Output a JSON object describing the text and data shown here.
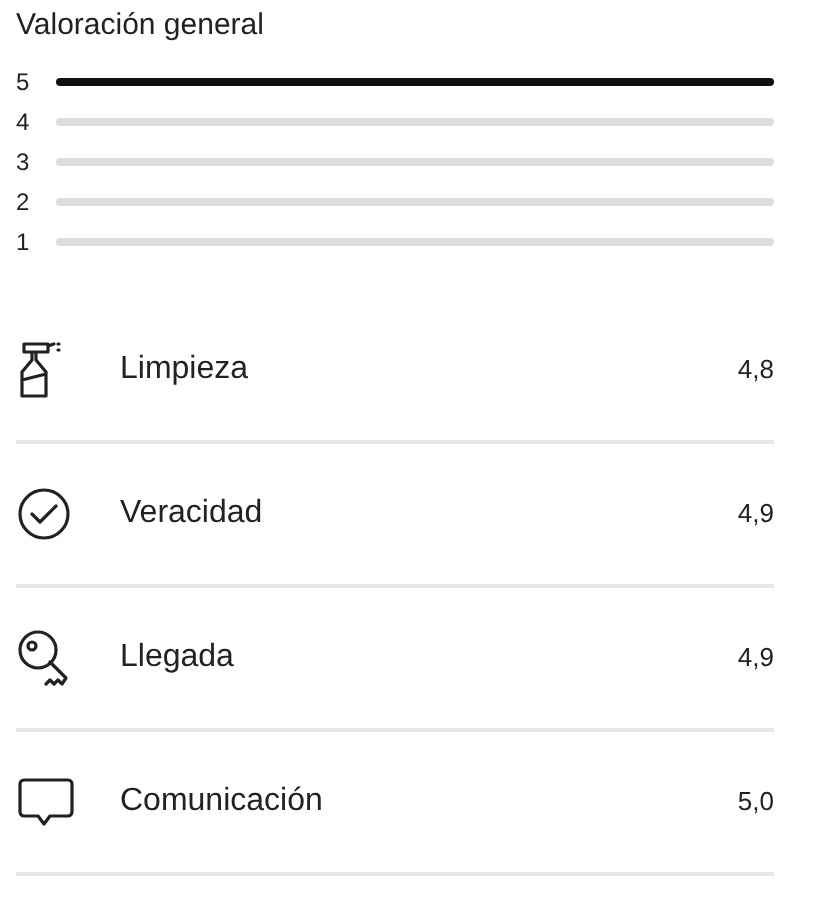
{
  "title": "Valoración general",
  "distribution": [
    {
      "label": "5",
      "full": true
    },
    {
      "label": "4",
      "full": false
    },
    {
      "label": "3",
      "full": false
    },
    {
      "label": "2",
      "full": false
    },
    {
      "label": "1",
      "full": false
    }
  ],
  "categories": [
    {
      "kind": "spray",
      "label": "Limpieza",
      "score": "4,8"
    },
    {
      "kind": "check",
      "label": "Veracidad",
      "score": "4,9"
    },
    {
      "kind": "key",
      "label": "Llegada",
      "score": "4,9"
    },
    {
      "kind": "chat",
      "label": "Comunicación",
      "score": "5,0"
    }
  ]
}
